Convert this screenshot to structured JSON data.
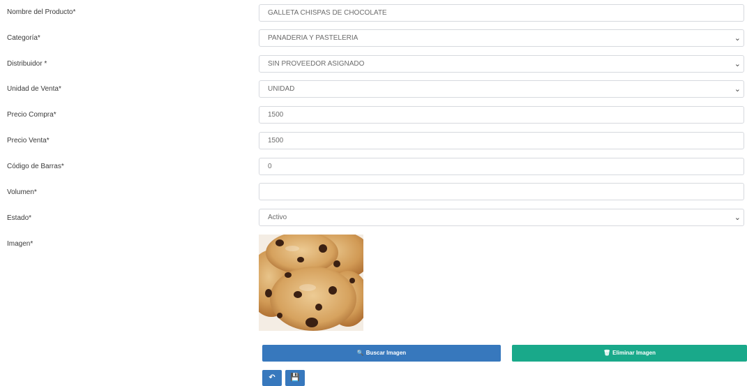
{
  "form": {
    "fields": [
      {
        "label": "Nombre del Producto*",
        "value": "GALLETA CHISPAS DE CHOCOLATE",
        "type": "text"
      },
      {
        "label": "Categoría*",
        "value": "PANADERIA Y PASTELERIA",
        "type": "select"
      },
      {
        "label": "Distribuidor *",
        "value": "SIN PROVEEDOR ASIGNADO",
        "type": "select"
      },
      {
        "label": "Unidad de Venta*",
        "value": "UNIDAD",
        "type": "select"
      },
      {
        "label": "Precio Compra*",
        "value": "1500",
        "type": "text"
      },
      {
        "label": "Precio Venta*",
        "value": "1500",
        "type": "text"
      },
      {
        "label": "Código de Barras*",
        "value": "0",
        "type": "text"
      },
      {
        "label": "Volumen*",
        "value": "",
        "type": "text"
      },
      {
        "label": "Estado*",
        "value": "Activo",
        "type": "select"
      }
    ],
    "image_label": "Imagen*",
    "image_alt": "chocolate-chip-cookies"
  },
  "buttons": {
    "search_image_label": "Buscar Imagen",
    "delete_image_label": "Eliminar Imagen",
    "search_icon": "search-icon",
    "delete_icon": "trash-icon",
    "back_icon": "undo-arrow-icon",
    "save_icon": "floppy-save-icon"
  },
  "colors": {
    "primary": "#3778bd",
    "success": "#19a98a",
    "border": "#d6d9de",
    "label_text": "#3a3a3a"
  }
}
